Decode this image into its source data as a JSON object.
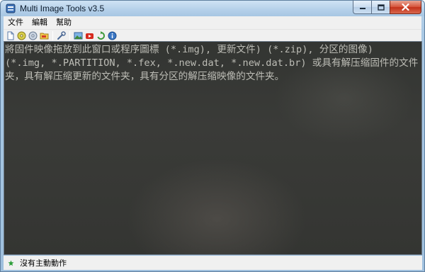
{
  "window": {
    "title": "Multi Image Tools v3.5"
  },
  "menu": {
    "items": [
      {
        "label": "文件"
      },
      {
        "label": "編輯"
      },
      {
        "label": "幫助"
      }
    ]
  },
  "toolbar": {
    "buttons": [
      {
        "icon": "new-file-icon"
      },
      {
        "icon": "open-disc-icon"
      },
      {
        "icon": "save-disc-icon"
      },
      {
        "icon": "folder-icon"
      },
      {
        "icon": "wrench-icon"
      },
      {
        "icon": "image-icon"
      },
      {
        "icon": "youtube-icon"
      },
      {
        "icon": "refresh-icon"
      },
      {
        "icon": "info-icon"
      }
    ]
  },
  "content": {
    "drop_lines": [
      "將固件映像拖放到此窗口或程序圖標 (*.img), 更新文件) (*.zip), 分区的图像)",
      "(*.img, *.PARTITION, *.fex, *.new.dat, *.new.dat.br) 或具有解压缩固件的文件",
      "夹，具有解压缩更新的文件夹，具有分区的解压缩映像的文件夹。"
    ]
  },
  "status": {
    "text": "沒有主動動作",
    "colors": {
      "indicator": "#2e9e3a"
    }
  }
}
